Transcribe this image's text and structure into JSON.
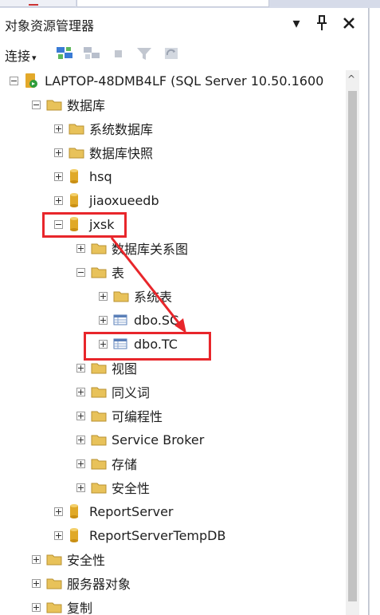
{
  "panel": {
    "title": "对象资源管理器",
    "buttons": {
      "dropdown": "▾",
      "pin": "ㅍ",
      "close": "✕"
    }
  },
  "toolbar": {
    "connect_label": "连接",
    "connect_arrow": "▾"
  },
  "tree": {
    "server": "LAPTOP-48DMB4LF (SQL Server 10.50.1600",
    "databases": "数据库",
    "system_databases": "系统数据库",
    "database_snapshots": "数据库快照",
    "db_hsq": "hsq",
    "db_jiaoxueedb": "jiaoxueedb",
    "db_jxsk": "jxsk",
    "db_diagrams": "数据库关系图",
    "tables": "表",
    "system_tables": "系统表",
    "table_sc": "dbo.SC",
    "table_tc": "dbo.TC",
    "views": "视图",
    "synonyms": "同义词",
    "programmability": "可编程性",
    "service_broker": "Service Broker",
    "storage": "存储",
    "db_security": "安全性",
    "db_reportserver": "ReportServer",
    "db_reportservertempdb": "ReportServerTempDB",
    "security": "安全性",
    "server_objects": "服务器对象",
    "replication": "复制"
  },
  "colors": {
    "highlight": "#e8262b",
    "folder": "#e8c25a",
    "database": "#e0a928"
  }
}
